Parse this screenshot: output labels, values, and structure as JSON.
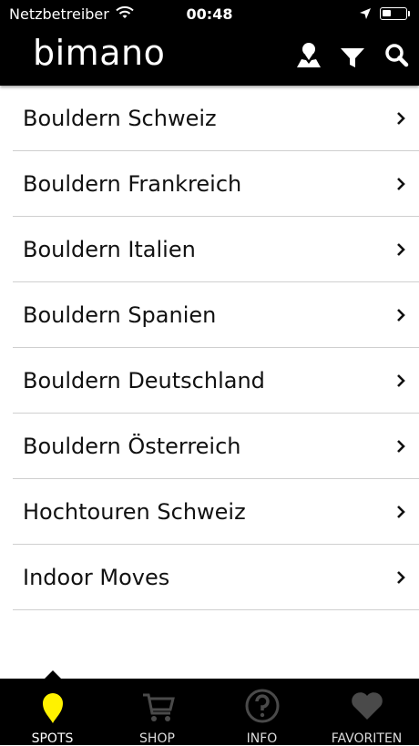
{
  "status_bar": {
    "carrier": "Netzbetreiber",
    "time": "00:48"
  },
  "header": {
    "logo": "bimano",
    "icons": [
      "map-person-icon",
      "filter-icon",
      "search-icon"
    ]
  },
  "list": {
    "items": [
      {
        "label": "Bouldern Schweiz"
      },
      {
        "label": "Bouldern Frankreich"
      },
      {
        "label": "Bouldern Italien"
      },
      {
        "label": "Bouldern Spanien"
      },
      {
        "label": "Bouldern Deutschland"
      },
      {
        "label": "Bouldern Österreich"
      },
      {
        "label": "Hochtouren Schweiz"
      },
      {
        "label": "Indoor Moves"
      }
    ]
  },
  "tabbar": {
    "tabs": [
      {
        "label": "SPOTS",
        "icon": "map-pin-icon",
        "active": true
      },
      {
        "label": "SHOP",
        "icon": "cart-icon",
        "active": false
      },
      {
        "label": "INFO",
        "icon": "help-icon",
        "active": false
      },
      {
        "label": "FAVORITEN",
        "icon": "heart-icon",
        "active": false
      }
    ]
  },
  "colors": {
    "bar_background": "#000000",
    "active_tab": "#fff200",
    "inactive_tab_icon": "#4a4a4a",
    "divider": "#cfcfcf"
  }
}
